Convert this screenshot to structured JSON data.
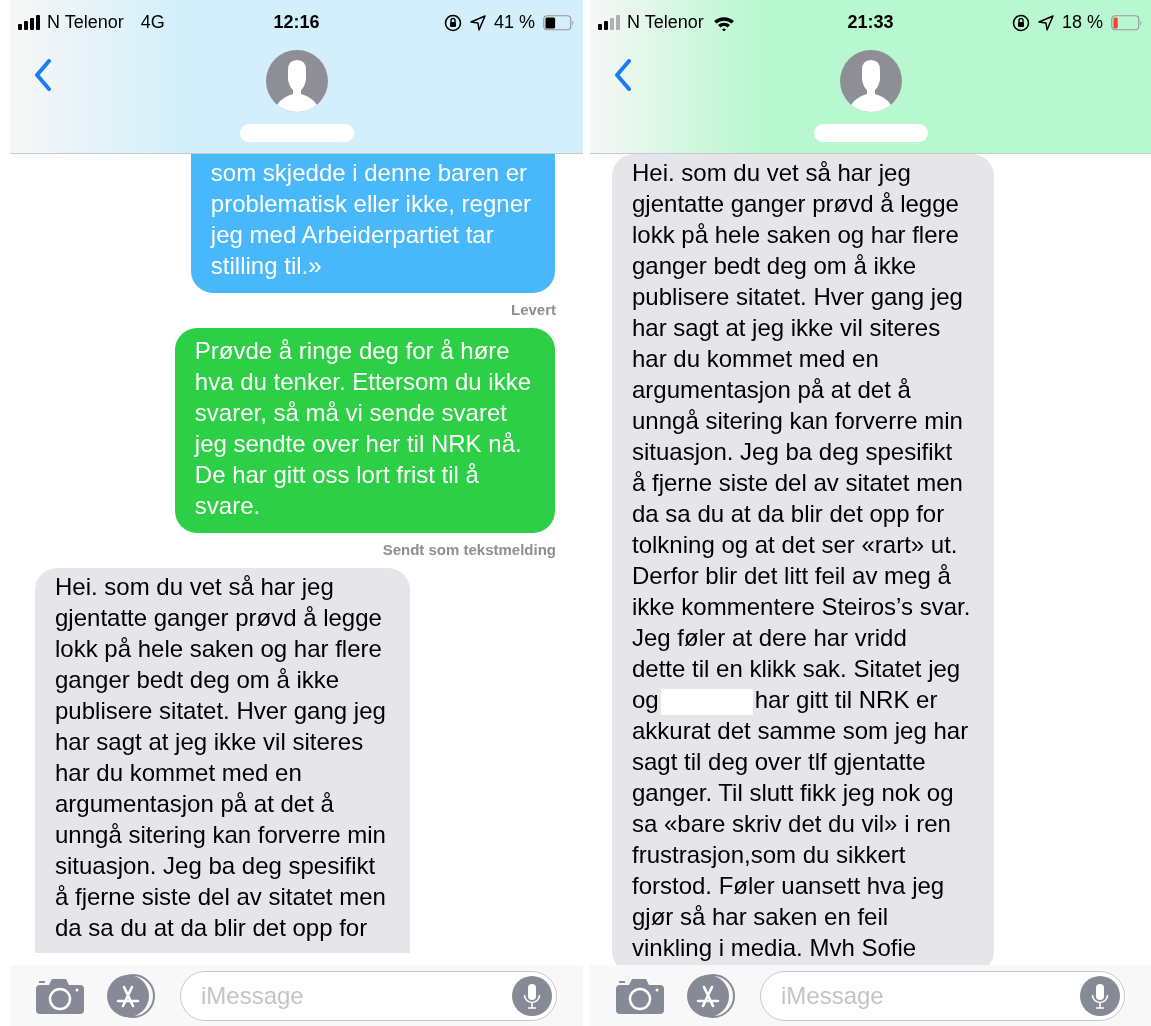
{
  "phones": [
    {
      "status_bar": {
        "carrier": "N Telenor",
        "network": "4G",
        "time": "12:16",
        "battery": "41 %"
      },
      "header": {
        "color": "#d2effb"
      },
      "messages": [
        {
          "kind": "sent_imessage",
          "lines": [
            "som skjedde i denne baren er",
            "problematisk eller ikke, regner",
            "jeg med Arbeiderpartiet tar",
            "stilling til.»"
          ]
        },
        {
          "kind": "receipt",
          "text": "Levert"
        },
        {
          "kind": "sent_sms",
          "lines": [
            "Prøvde å ringe deg for å høre",
            "hva du tenker. Ettersom du ikke",
            "svarer, så må vi sende svaret",
            "jeg sendte over her til NRK nå.",
            "De har gitt oss lort frist til å",
            "svare."
          ]
        },
        {
          "kind": "receipt",
          "text": "Sendt som tekstmelding"
        },
        {
          "kind": "received",
          "lines": [
            "Hei. som du vet så har jeg",
            "gjentatte ganger prøvd å legge",
            "lokk på hele saken og har flere",
            "ganger bedt deg om å ikke",
            "publisere sitatet. Hver gang jeg",
            "har sagt at jeg ikke vil siteres",
            "har du kommet med en",
            "argumentasjon på at det å",
            "unngå sitering kan forverre min",
            "situasjon. Jeg ba deg spesifikt",
            "å fjerne siste del av sitatet men",
            "da sa du at da blir det opp for"
          ]
        }
      ],
      "composer": {
        "placeholder": "iMessage"
      }
    },
    {
      "status_bar": {
        "carrier": "N Telenor",
        "wifi": true,
        "time": "21:33",
        "battery": "18 %"
      },
      "header": {
        "color": "#b8f8d0"
      },
      "messages": [
        {
          "kind": "received",
          "lines": [
            "Hei. som du vet så har jeg",
            "gjentatte ganger prøvd å legge",
            "lokk på hele saken og har flere",
            "ganger bedt deg om å ikke",
            "publisere sitatet. Hver gang jeg",
            "har sagt at jeg ikke vil siteres",
            "har du kommet med en",
            "argumentasjon på at det å",
            "unngå sitering kan forverre min",
            "situasjon. Jeg ba deg spesifikt",
            "å fjerne siste del av sitatet men",
            "da sa du at da blir det opp for",
            "tolkning og at det ser «rart» ut.",
            "Derfor blir det litt feil av meg å",
            "ikke kommentere Steiros’s svar.",
            "Jeg føler at dere har vridd",
            "dette til en klikk sak. Sitatet jeg",
            {
              "kind": "redacted",
              "parts": [
                "og",
                "har gitt til NRK er"
              ]
            },
            "akkurat det samme som jeg har",
            "sagt til deg over tlf gjentatte",
            "ganger. Til slutt fikk jeg nok og",
            "sa «bare skriv det du vil» i ren",
            "frustrasjon,som du sikkert",
            "forstod. Føler uansett hva jeg",
            "gjør så har saken en feil",
            "vinkling i media. Mvh Sofie"
          ]
        }
      ],
      "composer": {
        "placeholder": "iMessage"
      }
    }
  ]
}
